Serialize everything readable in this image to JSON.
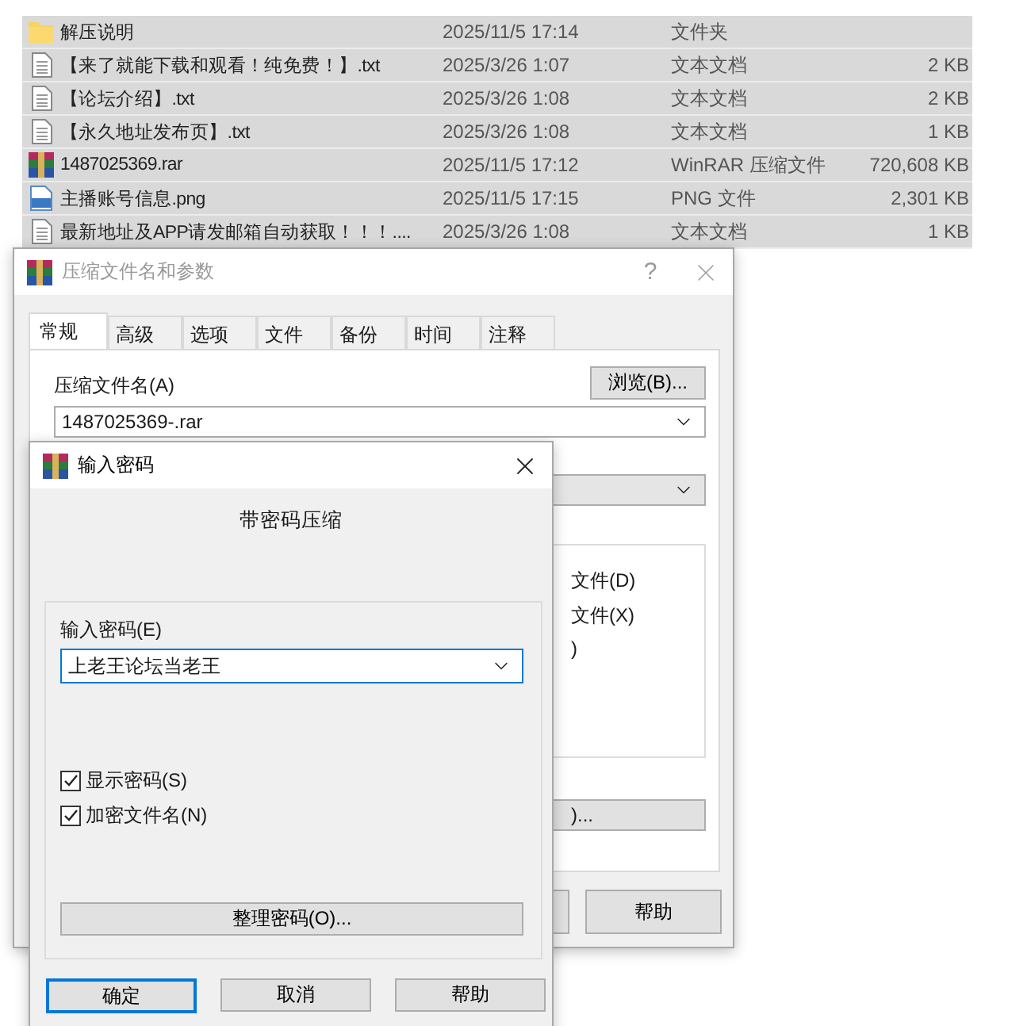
{
  "file_list": {
    "rows": [
      {
        "kind": "folder",
        "name": "解压说明",
        "modified": "2025/11/5 17:14",
        "type": "文件夹",
        "size": "",
        "selected": true
      },
      {
        "kind": "text",
        "name": "【来了就能下载和观看！纯免费！】.txt",
        "modified": "2025/3/26 1:07",
        "type": "文本文档",
        "size": "2 KB",
        "selected": true
      },
      {
        "kind": "text",
        "name": "【论坛介绍】.txt",
        "modified": "2025/3/26 1:08",
        "type": "文本文档",
        "size": "2 KB",
        "selected": true
      },
      {
        "kind": "text",
        "name": "【永久地址发布页】.txt",
        "modified": "2025/3/26 1:08",
        "type": "文本文档",
        "size": "1 KB",
        "selected": true
      },
      {
        "kind": "archive",
        "name": "1487025369.rar",
        "modified": "2025/11/5 17:12",
        "type": "WinRAR 压缩文件",
        "size": "720,608 KB",
        "selected": true
      },
      {
        "kind": "image",
        "name": "主播账号信息.png",
        "modified": "2025/11/5 17:15",
        "type": "PNG 文件",
        "size": "2,301 KB",
        "selected": true
      },
      {
        "kind": "text",
        "name": "最新地址及APP请发邮箱自动获取！！！....",
        "modified": "2025/3/26 1:08",
        "type": "文本文档",
        "size": "1 KB",
        "selected": true
      }
    ]
  },
  "archive_dialog": {
    "title": "压缩文件名和参数",
    "help_glyph": "?",
    "active": false,
    "tabs": [
      {
        "label": "常规",
        "selected": true
      },
      {
        "label": "高级",
        "selected": false
      },
      {
        "label": "选项",
        "selected": false
      },
      {
        "label": "文件",
        "selected": false
      },
      {
        "label": "备份",
        "selected": false
      },
      {
        "label": "时间",
        "selected": false
      },
      {
        "label": "注释",
        "selected": false
      }
    ],
    "archive_name_label": "压缩文件名(A)",
    "browse_button": "浏览(B)...",
    "archive_name": "1487025369-.rar",
    "partial_options": [
      "文件(D)",
      "文件(X)",
      ")"
    ],
    "partial_button": ")...",
    "help_button": "帮助"
  },
  "password_dialog": {
    "title": "输入密码",
    "active": true,
    "heading": "带密码压缩",
    "password_label": "输入密码(E)",
    "password": "上老王论坛当老王",
    "options": [
      {
        "label": "显示密码(S)",
        "checked": true
      },
      {
        "label": "加密文件名(N)",
        "checked": true
      }
    ],
    "organize_button": "整理密码(O)...",
    "buttons": [
      {
        "label": "确定",
        "default": true
      },
      {
        "label": "取消",
        "default": false
      },
      {
        "label": "帮助",
        "default": false
      }
    ]
  }
}
